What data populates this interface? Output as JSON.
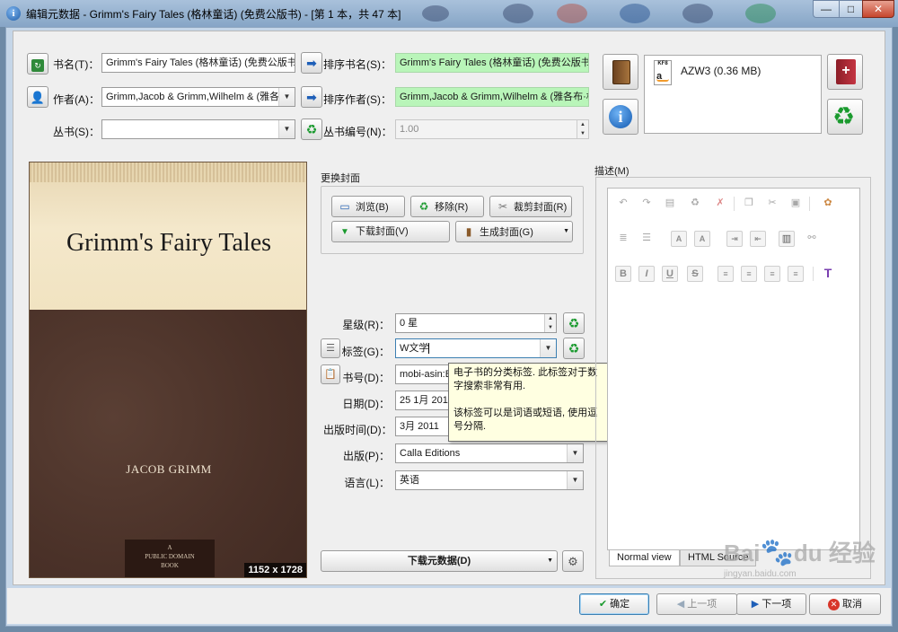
{
  "window": {
    "title": "编辑元数据 - Grimm's Fairy Tales (格林童话) (免费公版书) - [第 1 本，共 47 本]",
    "minimize": "—",
    "maximize": "□",
    "close": "✕"
  },
  "fields": {
    "title_label": "书名(T)：",
    "title_value": "Grimm's Fairy Tales (格林童话) (免费公版书)",
    "title_sort_label": "排序书名(S)：",
    "title_sort_value": "Grimm's Fairy Tales (格林童话) (免费公版书)",
    "author_label": "作者(A)：",
    "author_value": "Grimm,Jacob & Grimm,Wilhelm & (雅各布·",
    "author_sort_label": "排序作者(S)：",
    "author_sort_value": "Grimm,Jacob & Grimm,Wilhelm & (雅各布·格林",
    "series_label": "丛书(S)：",
    "series_value": "",
    "series_index_label": "丛书编号(N)：",
    "series_index_value": "1.00"
  },
  "formats": {
    "items": [
      {
        "label": "AZW3 (0.36 MB)",
        "badge": "KF8"
      }
    ]
  },
  "cover": {
    "section_label": "更换封面",
    "title": "Grimm's Fairy Tales",
    "author": "JACOB GRIMM",
    "badge_lines": [
      "A",
      "PUBLIC DOMAIN",
      "BOOK"
    ],
    "dimensions": "1152 x 1728",
    "browse": "浏览(B)",
    "remove": "移除(R)",
    "trim": "裁剪封面(R)",
    "download": "下载封面(V)",
    "generate": "生成封面(G)"
  },
  "meta": {
    "rating_label": "星级(R)：",
    "rating_value": "0 星",
    "tags_label": "标签(G)：",
    "tags_value": "W文学",
    "ids_label": "书号(D)：",
    "ids_value": "mobi-asin:B",
    "date_label": "日期(D)：",
    "date_value": "25 1月 2016",
    "pubdate_label": "出版时间(D)：",
    "pubdate_value": "3月 2011",
    "publisher_label": "出版(P)：",
    "publisher_value": "Calla Editions",
    "language_label": "语言(L)：",
    "language_value": "英语",
    "download_metadata": "下载元数据(D)"
  },
  "tooltip": {
    "line1": "电子书的分类标签. 此标签对于数字搜索非常有用.",
    "line2": "该标签可以是词语或短语, 使用逗号分隔."
  },
  "description": {
    "label": "描述(M)",
    "tab_normal": "Normal view",
    "tab_html": "HTML Source"
  },
  "footer": {
    "ok": "确定",
    "prev": "上一项",
    "next": "下一项",
    "cancel": "取消"
  },
  "watermark": {
    "text": "Bai",
    "paw": "🐾",
    "text2": "du 经验",
    "url": "jingyan.baidu.com"
  },
  "colors": {
    "accent": "#3c7fb1",
    "sort_field_bg": "#b9f5b9",
    "tooltip_bg": "#ffffe1",
    "close_button": "#c6452d"
  }
}
